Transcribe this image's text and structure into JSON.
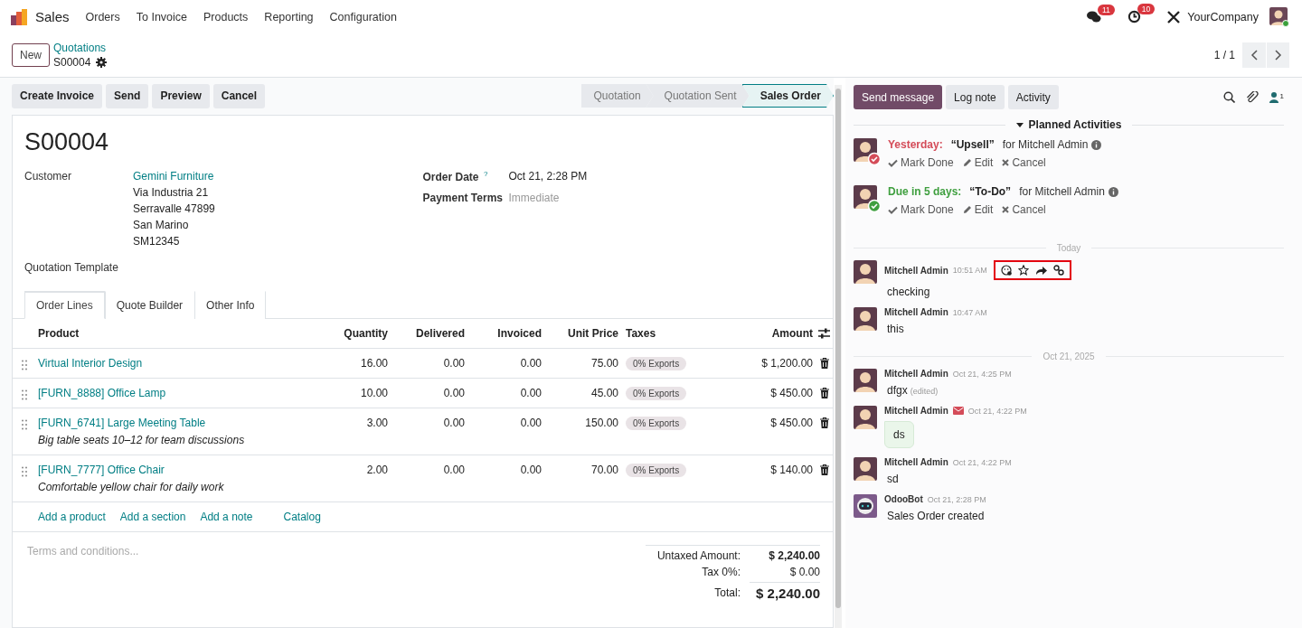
{
  "navbar": {
    "app_name": "Sales",
    "menu": [
      "Orders",
      "To Invoice",
      "Products",
      "Reporting",
      "Configuration"
    ],
    "notifications": [
      {
        "kind": "chat",
        "count": "11"
      },
      {
        "kind": "activity",
        "count": "10"
      }
    ],
    "company": "YourCompany"
  },
  "control_panel": {
    "new_button": "New",
    "breadcrumb": "Quotations",
    "record": "S00004",
    "pager": "1 / 1"
  },
  "action_buttons": [
    "Create Invoice",
    "Send",
    "Preview",
    "Cancel"
  ],
  "status_steps": [
    {
      "label": "Quotation",
      "selected": false
    },
    {
      "label": "Quotation Sent",
      "selected": false
    },
    {
      "label": "Sales Order",
      "selected": true
    }
  ],
  "form": {
    "title": "S00004",
    "customer_label": "Customer",
    "customer_name": "Gemini Furniture",
    "address": [
      "Via Industria 21",
      "Serravalle 47899",
      "San Marino",
      "SM12345"
    ],
    "order_date_label": "Order Date",
    "order_date_help": "?",
    "order_date": "Oct 21, 2:28 PM",
    "payment_terms_label": "Payment Terms",
    "payment_terms_placeholder": "Immediate",
    "template_label": "Quotation Template"
  },
  "tabs": [
    {
      "label": "Order Lines",
      "selected": true
    },
    {
      "label": "Quote Builder",
      "selected": false
    },
    {
      "label": "Other Info",
      "selected": false
    }
  ],
  "table": {
    "columns": [
      "Product",
      "Quantity",
      "Delivered",
      "Invoiced",
      "Unit Price",
      "Taxes",
      "Amount"
    ],
    "rows": [
      {
        "product": "Virtual Interior Design",
        "quantity": "16.00",
        "delivered": "0.00",
        "invoiced": "0.00",
        "unit_price": "75.00",
        "tax": "0% Exports",
        "amount": "$ 1,200.00"
      },
      {
        "product": "[FURN_8888] Office Lamp",
        "quantity": "10.00",
        "delivered": "0.00",
        "invoiced": "0.00",
        "unit_price": "45.00",
        "tax": "0% Exports",
        "amount": "$ 450.00"
      },
      {
        "product": "[FURN_6741] Large Meeting Table",
        "description": "Big table seats 10–12 for team discussions",
        "quantity": "3.00",
        "delivered": "0.00",
        "invoiced": "0.00",
        "unit_price": "150.00",
        "tax": "0% Exports",
        "amount": "$ 450.00"
      },
      {
        "product": "[FURN_7777] Office Chair",
        "description": "Comfortable yellow chair for daily work",
        "quantity": "2.00",
        "delivered": "0.00",
        "invoiced": "0.00",
        "unit_price": "70.00",
        "tax": "0% Exports",
        "amount": "$ 140.00"
      }
    ],
    "add_links": [
      "Add a product",
      "Add a section",
      "Add a note",
      "Catalog"
    ]
  },
  "terms_placeholder": "Terms and conditions...",
  "totals": [
    {
      "label": "Untaxed Amount:",
      "value": "$ 2,240.00",
      "kind": "subtotal"
    },
    {
      "label": "Tax 0%:",
      "value": "$ 0.00",
      "kind": "tax"
    },
    {
      "label": "Total:",
      "value": "$ 2,240.00",
      "kind": "total"
    }
  ],
  "chatter": {
    "buttons": [
      {
        "label": "Send message",
        "selected": true
      },
      {
        "label": "Log note",
        "selected": false
      },
      {
        "label": "Activity",
        "selected": false
      }
    ],
    "followers": "1",
    "planned": {
      "label": "Planned Activities",
      "expanded": true
    },
    "activities": [
      {
        "kind": "overdue",
        "due": "Yesterday:",
        "title": "“Upsell”",
        "assignee": "for Mitchell Admin",
        "actions": [
          "Mark Done",
          "Edit",
          "Cancel"
        ]
      },
      {
        "kind": "planned",
        "due": "Due in 5 days:",
        "title": "“To-Do”",
        "assignee": "for Mitchell Admin",
        "actions": [
          "Mark Done",
          "Edit",
          "Cancel"
        ]
      }
    ],
    "timeline": [
      {
        "kind": "separator",
        "label": "Today"
      },
      {
        "kind": "note",
        "author": "Mitchell Admin",
        "time": "10:51 AM",
        "body": "checking",
        "via_email": false,
        "hover_actions": true
      },
      {
        "kind": "note",
        "author": "Mitchell Admin",
        "time": "10:47 AM",
        "body": "this",
        "via_email": false,
        "hover_actions": false
      },
      {
        "kind": "separator",
        "label": "Oct 21, 2025"
      },
      {
        "kind": "note",
        "author": "Mitchell Admin",
        "time": "Oct 21, 4:25 PM",
        "body": "dfgx",
        "edited": "(edited)",
        "via_email": false,
        "hover_actions": false
      },
      {
        "kind": "message",
        "author": "Mitchell Admin",
        "time": "Oct 21, 4:22 PM",
        "body": "ds",
        "via_email": true,
        "hover_actions": false
      },
      {
        "kind": "note",
        "author": "Mitchell Admin",
        "time": "Oct 21, 4:22 PM",
        "body": "sd",
        "via_email": false,
        "hover_actions": false
      },
      {
        "kind": "bot_note",
        "author": "OdooBot",
        "time": "Oct 21, 2:28 PM",
        "body": "Sales Order created",
        "via_email": false,
        "hover_actions": false
      }
    ]
  }
}
